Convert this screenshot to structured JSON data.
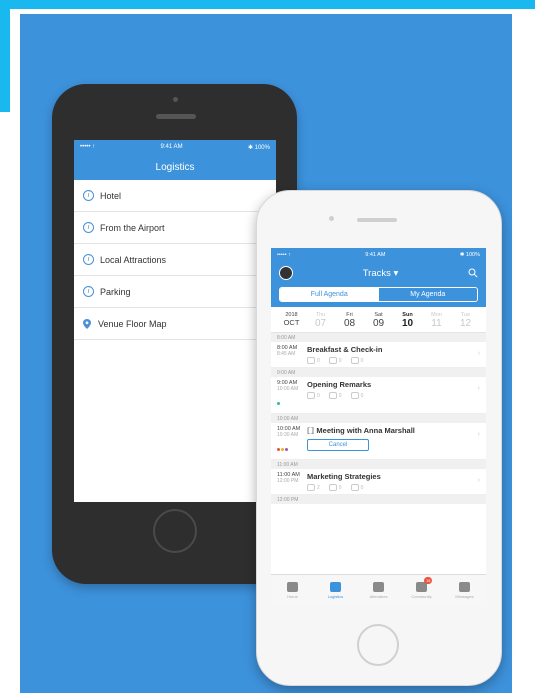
{
  "colors": {
    "brand_blue": "#3d92dc",
    "frame_cyan": "#19b9f0"
  },
  "logistics_phone": {
    "status": {
      "carrier": "••••• ↑",
      "time": "9:41 AM",
      "battery": "✱ 100%"
    },
    "title": "Logistics",
    "items": [
      {
        "label": "Hotel",
        "icon": "info-icon"
      },
      {
        "label": "From the Airport",
        "icon": "info-icon"
      },
      {
        "label": "Local Attractions",
        "icon": "info-icon"
      },
      {
        "label": "Parking",
        "icon": "info-icon"
      },
      {
        "label": "Venue Floor Map",
        "icon": "map-pin-icon"
      }
    ]
  },
  "agenda_phone": {
    "status": {
      "carrier": "••••• ↑",
      "time": "9:41 AM",
      "battery": "✱ 100%"
    },
    "title": "Tracks ▾",
    "tabs": {
      "full": "Full Agenda",
      "mine": "My Agenda"
    },
    "dates": [
      {
        "top": "2018",
        "bottom": "OCT"
      },
      {
        "top": "Thu",
        "bottom": "07"
      },
      {
        "top": "Fri",
        "bottom": "08"
      },
      {
        "top": "Sat",
        "bottom": "09"
      },
      {
        "top": "Sun",
        "bottom": "10"
      },
      {
        "top": "Mon",
        "bottom": "11"
      },
      {
        "top": "Tue",
        "bottom": "12"
      }
    ],
    "sections": [
      "8:00 AM",
      "9:00 AM",
      "10:00 AM",
      "11:00 AM",
      "12:00 PM"
    ],
    "sessions": [
      {
        "start": "8:00 AM",
        "end": "8:45 AM",
        "title": "Breakfast & Check-in",
        "counts": [
          "0",
          "0",
          "0"
        ]
      },
      {
        "start": "9:00 AM",
        "end": "10:00 AM",
        "title": "Opening Remarks",
        "counts": [
          "0",
          "0",
          "0"
        ]
      },
      {
        "start": "10:00 AM",
        "end": "10:30 AM",
        "title": "Meeting with Anna Marshall",
        "action": "Cancel"
      },
      {
        "start": "11:00 AM",
        "end": "12:00 PM",
        "title": "Marketing Strategies",
        "counts": [
          "2",
          "0",
          "0"
        ]
      }
    ],
    "tabbar": [
      {
        "label": "Home",
        "icon": "home-icon"
      },
      {
        "label": "Logistics",
        "icon": "logistics-icon"
      },
      {
        "label": "Attendees",
        "icon": "attendees-icon"
      },
      {
        "label": "Community",
        "icon": "community-icon",
        "badge": "15"
      },
      {
        "label": "Messages",
        "icon": "messages-icon"
      }
    ]
  }
}
